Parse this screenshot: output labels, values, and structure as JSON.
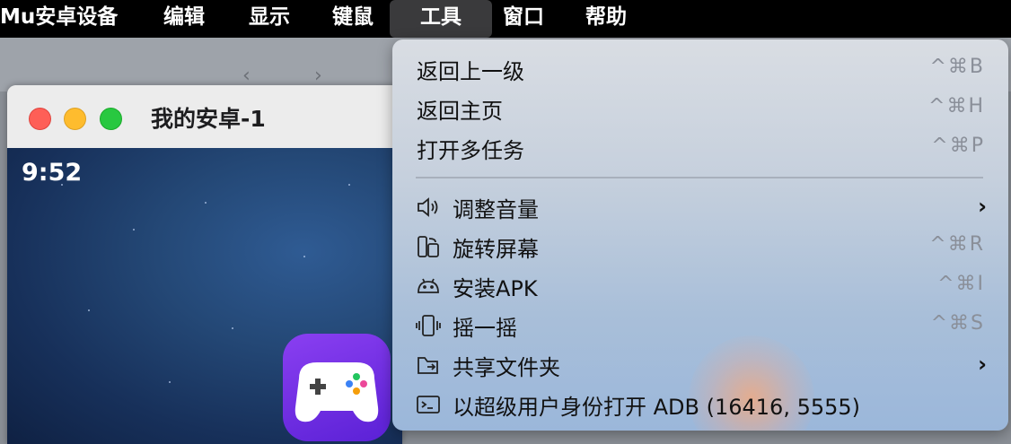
{
  "menubar": {
    "app": "Mu安卓设备",
    "items": [
      "编辑",
      "显示",
      "键鼠",
      "工具",
      "窗口",
      "帮助"
    ]
  },
  "window": {
    "title": "我的安卓-1",
    "clock": "9:52"
  },
  "tools_menu": {
    "items": [
      {
        "label": "返回上一级",
        "shortcut": "^⌘B"
      },
      {
        "label": "返回主页",
        "shortcut": "^⌘H"
      },
      {
        "label": "打开多任务",
        "shortcut": "^⌘P"
      },
      {
        "label": "调整音量",
        "icon": "speaker-icon",
        "submenu": true
      },
      {
        "label": "旋转屏幕",
        "icon": "rotate-screen-icon",
        "shortcut": "^⌘R"
      },
      {
        "label": "安装APK",
        "icon": "android-icon",
        "shortcut": "^⌘I"
      },
      {
        "label": "摇一摇",
        "icon": "shake-phone-icon",
        "shortcut": "^⌘S"
      },
      {
        "label": "共享文件夹",
        "icon": "shared-folder-icon",
        "submenu": true
      },
      {
        "label": "以超级用户身份打开 ADB (16416, 5555)",
        "icon": "terminal-icon"
      }
    ],
    "submenu_arrow": "›"
  },
  "colors": {
    "menubar": "#000000",
    "menu_bg": "#c6d0dd",
    "traffic_red": "#fe5f57",
    "traffic_yellow": "#febc2e",
    "traffic_green": "#28c840",
    "game_icon": "#6d2fe0"
  }
}
